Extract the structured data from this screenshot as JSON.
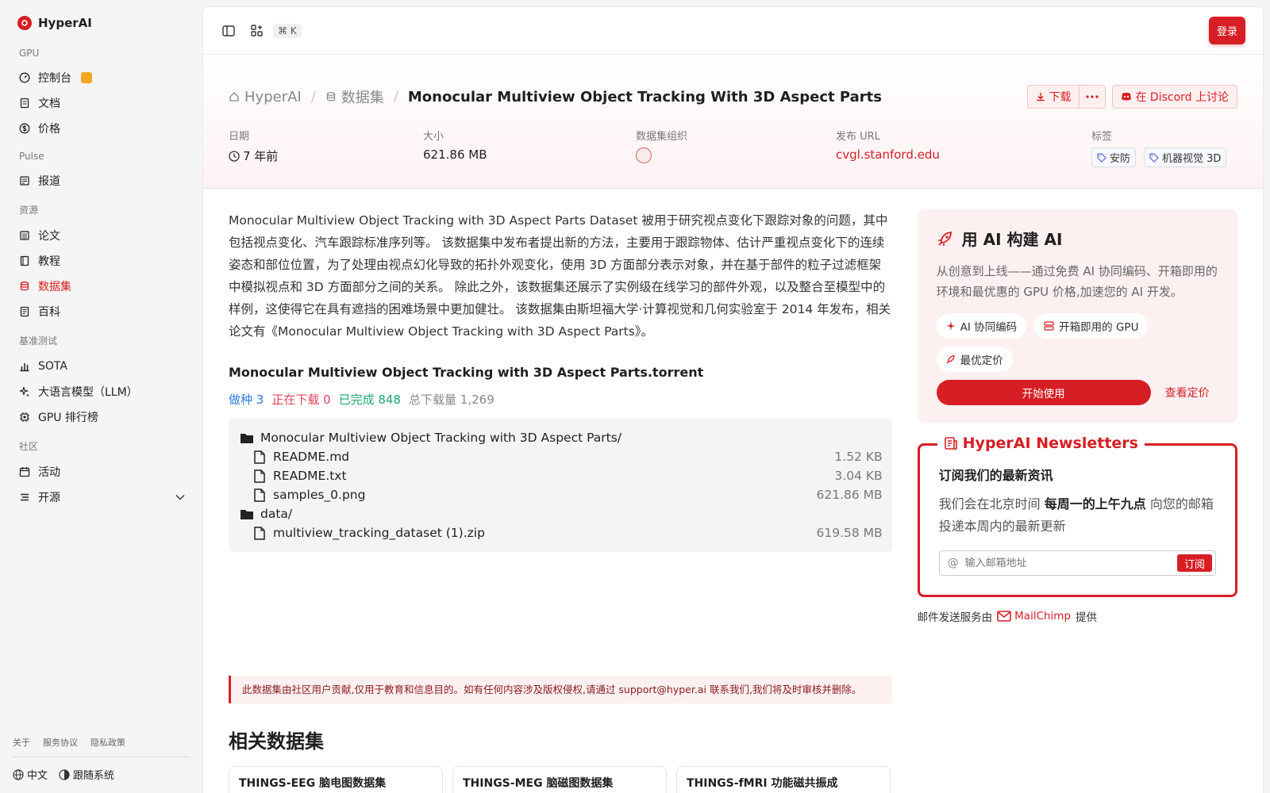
{
  "sidebar": {
    "brand": "HyperAI",
    "sections": [
      {
        "label": "GPU",
        "items": [
          {
            "label": "控制台",
            "icon": "gauge-icon"
          },
          {
            "label": "文档",
            "icon": "book-icon"
          },
          {
            "label": "价格",
            "icon": "dollar-icon"
          }
        ]
      },
      {
        "label": "Pulse",
        "items": [
          {
            "label": "报道",
            "icon": "newspaper-icon"
          }
        ]
      },
      {
        "label": "资源",
        "items": [
          {
            "label": "论文",
            "icon": "paper-icon"
          },
          {
            "label": "教程",
            "icon": "tutorial-icon"
          },
          {
            "label": "数据集",
            "icon": "database-icon",
            "active": true
          },
          {
            "label": "百科",
            "icon": "wiki-icon"
          }
        ]
      },
      {
        "label": "基准测试",
        "items": [
          {
            "label": "SOTA",
            "icon": "bar-chart-icon"
          },
          {
            "label": "大语言模型（LLM）",
            "icon": "sparkle-icon"
          },
          {
            "label": "GPU 排行榜",
            "icon": "chip-icon"
          }
        ]
      },
      {
        "label": "社区",
        "items": [
          {
            "label": "活动",
            "icon": "calendar-icon"
          },
          {
            "label": "开源",
            "icon": "list-icon"
          }
        ]
      }
    ],
    "footer_links": [
      "关于",
      "服务协议",
      "隐私政策"
    ],
    "language": "中文",
    "theme": "跟随系统"
  },
  "topbar": {
    "shortcut": "⌘ K",
    "login": "登录"
  },
  "breadcrumb": {
    "home": "HyperAI",
    "datasets": "数据集",
    "current": "Monocular Multiview Object Tracking With 3D Aspect Parts"
  },
  "actions": {
    "download": "下载",
    "discord": "在 Discord 上讨论"
  },
  "meta": {
    "date_label": "日期",
    "date_value": "7 年前",
    "size_label": "大小",
    "size_value": "621.86 MB",
    "org_label": "数据集组织",
    "url_label": "发布 URL",
    "url_value": "cvgl.stanford.edu",
    "tags_label": "标签",
    "tags": [
      "安防",
      "机器视觉 3D"
    ]
  },
  "description": "Monocular Multiview Object Tracking with 3D Aspect Parts Dataset 被用于研究视点变化下跟踪对象的问题，其中包括视点变化、汽车跟踪标准序列等。 该数据集中发布者提出新的方法，主要用于跟踪物体、估计严重视点变化下的连续姿态和部位位置，为了处理由视点幻化导致的拓扑外观变化，使用 3D 方面部分表示对象，并在基于部件的粒子过滤框架中模拟视点和 3D 方面部分之间的关系。 除此之外，该数据集还展示了实例级在线学习的部件外观，以及整合至模型中的样例，这使得它在具有遮挡的困难场景中更加健壮。 该数据集由斯坦福大学·计算视觉和几何实验室于 2014 年发布，相关论文有《Monocular Multiview Object Tracking with 3D Aspect Parts》。",
  "torrent": {
    "title": "Monocular Multiview Object Tracking with 3D Aspect Parts.torrent",
    "seeding": "做种 3",
    "downloading": "正在下载 0",
    "completed": "已完成 848",
    "total": "总下载量 1,269",
    "files": [
      {
        "name": "Monocular Multiview Object Tracking with 3D Aspect Parts/",
        "type": "folder",
        "size": "",
        "indent": false
      },
      {
        "name": "README.md",
        "type": "file",
        "size": "1.52 KB",
        "indent": true
      },
      {
        "name": "README.txt",
        "type": "file",
        "size": "3.04 KB",
        "indent": true
      },
      {
        "name": "samples_0.png",
        "type": "file",
        "size": "621.86 MB",
        "indent": true
      },
      {
        "name": "data/",
        "type": "folder",
        "size": "",
        "indent": false
      },
      {
        "name": "multiview_tracking_dataset (1).zip",
        "type": "file",
        "size": "619.58 MB",
        "indent": true
      }
    ]
  },
  "notice": {
    "before": "此数据集由社区用户贡献,仅用于教育和信息目的。如有任何内容涉及版权侵权,请通过 ",
    "email": "support@hyper.ai",
    "after": " 联系我们,我们将及时审核并删除。"
  },
  "related": {
    "title": "相关数据集",
    "cards": [
      "THINGS-EEG 脑电图数据集",
      "THINGS-MEG 脑磁图数据集",
      "THINGS-fMRI 功能磁共振成"
    ]
  },
  "ai_card": {
    "title": "用 AI 构建 AI",
    "desc": "从创意到上线——通过免费 AI 协同编码、开箱即用的环境和最优惠的 GPU 价格,加速您的 AI 开发。",
    "chips": [
      "AI 协同编码",
      "开箱即用的 GPU",
      "最优定价"
    ],
    "start": "开始使用",
    "pricing": "查看定价"
  },
  "newsletter": {
    "legend": "HyperAI Newsletters",
    "title": "订阅我们的最新资讯",
    "desc_before": "我们会在北京时间 ",
    "desc_bold": "每周一的上午九点",
    "desc_after": " 向您的邮箱投递本周内的最新更新",
    "placeholder": "输入邮箱地址",
    "subscribe": "订阅",
    "powered_before": "邮件发送服务由",
    "powered_brand": "MailChimp",
    "powered_after": "提供"
  }
}
